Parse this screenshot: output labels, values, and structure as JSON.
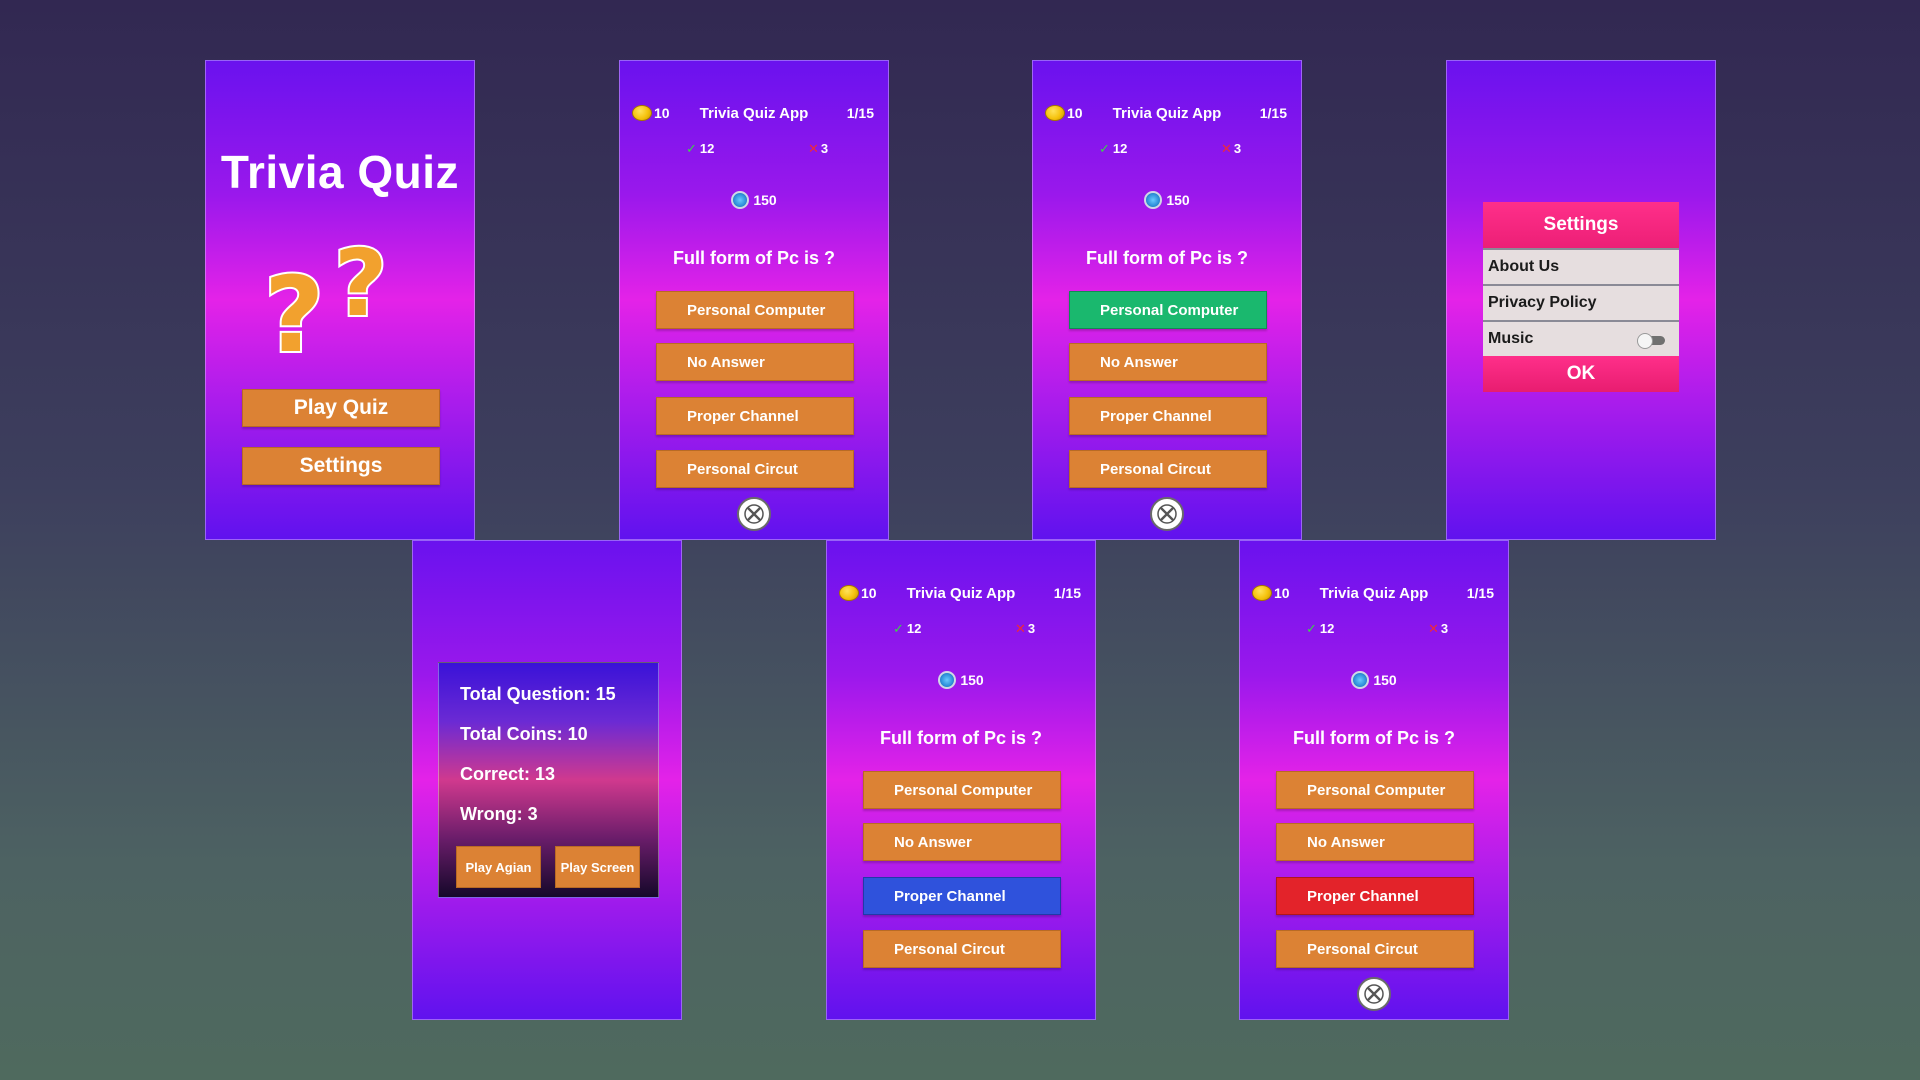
{
  "home": {
    "title": "Trivia Quiz",
    "play_label": "Play Quiz",
    "settings_label": "Settings"
  },
  "quiz": {
    "app_title": "Trivia Quiz App",
    "coins": "10",
    "progress": "1/15",
    "correct_count": "12",
    "wrong_count": "3",
    "timer": "150",
    "question": "Full form of Pc is ?",
    "options": [
      "Personal Computer",
      "No Answer",
      "Proper Channel",
      "Personal Circut"
    ]
  },
  "settings": {
    "title": "Settings",
    "items": [
      "About Us",
      "Privacy Policy",
      "Music"
    ],
    "music_on": false,
    "ok_label": "OK"
  },
  "results": {
    "total_question": "Total Question: 15",
    "total_coins": "Total Coins: 10",
    "correct": "Correct: 13",
    "wrong": "Wrong: 3",
    "play_again_label": "Play Agian",
    "play_screen_label": "Play Screen"
  },
  "colors": {
    "option": "#dc8234",
    "correct_answer": "#1ab86e",
    "selected_answer": "#2f52dc",
    "wrong_answer": "#e3232a",
    "dialog_accent": "#ff2f8a"
  }
}
